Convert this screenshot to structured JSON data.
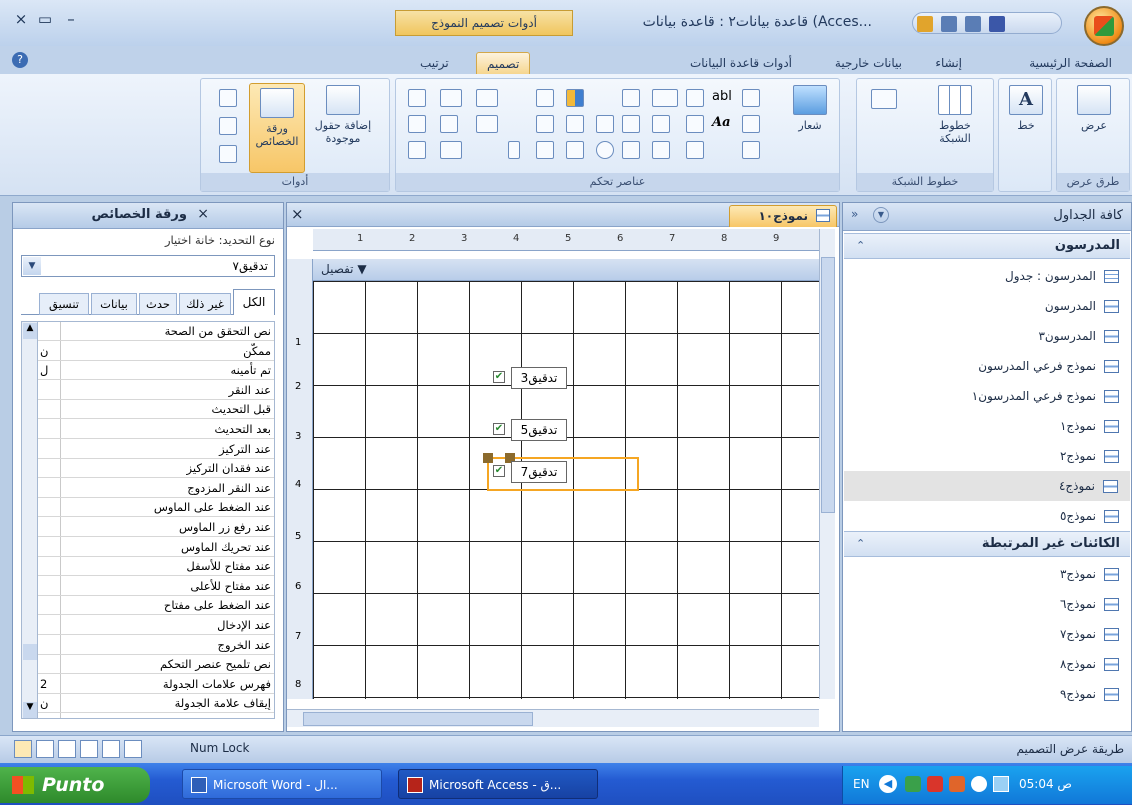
{
  "window": {
    "title": "قاعدة بيانات٢ : قاعدة بيانات (Acces...",
    "context_tab_group": "أدوات تصميم النموذج",
    "close_glyph": "×",
    "restore_glyph": "▭",
    "minimize_glyph": "–"
  },
  "tabs": [
    {
      "label": "الصفحة الرئيسية"
    },
    {
      "label": "إنشاء"
    },
    {
      "label": "بيانات خارجية"
    },
    {
      "label": "أدوات قاعدة البيانات"
    },
    {
      "label": "تصميم",
      "active": true
    },
    {
      "label": "ترتيب"
    }
  ],
  "ribbon": {
    "views_group": {
      "label": "طرق عرض",
      "button": "عرض"
    },
    "font_group": {
      "button_letter": "A",
      "button": "خط"
    },
    "gridlines_group": {
      "label": "خطوط الشبكة",
      "button": "خطوط الشبكة"
    },
    "controls_group": {
      "label": "عناصر تحكم",
      "logo_button": "شعار",
      "textbox_glyph": "abl",
      "label_glyph": "Aa"
    },
    "tools_group": {
      "label": "أدوات",
      "add_fields_button": "إضافة حقول موجودة",
      "property_sheet_button": "ورقة الخصائص"
    }
  },
  "properties": {
    "title": "ورقة الخصائص",
    "selection_type_label": "نوع التحديد:",
    "selection_type": "خانة اختيار",
    "selected_control": "تدقيق٧",
    "tabs": [
      "الكل",
      "غير ذلك",
      "حدث",
      "بيانات",
      "تنسيق"
    ],
    "rows": [
      {
        "name": "نص التحقق من الصحة",
        "value": ""
      },
      {
        "name": "ممكّن",
        "value": "ن"
      },
      {
        "name": "تم تأمينه",
        "value": "ل"
      },
      {
        "name": "عند النقر",
        "value": ""
      },
      {
        "name": "قبل التحديث",
        "value": ""
      },
      {
        "name": "بعد التحديث",
        "value": ""
      },
      {
        "name": "عند التركيز",
        "value": ""
      },
      {
        "name": "عند فقدان التركيز",
        "value": ""
      },
      {
        "name": "عند النقر المزدوج",
        "value": ""
      },
      {
        "name": "عند الضغط على الماوس",
        "value": ""
      },
      {
        "name": "عند رفع زر الماوس",
        "value": ""
      },
      {
        "name": "عند تحريك الماوس",
        "value": ""
      },
      {
        "name": "عند مفتاح للأسفل",
        "value": ""
      },
      {
        "name": "عند مفتاح للأعلى",
        "value": ""
      },
      {
        "name": "عند الضغط على مفتاح",
        "value": ""
      },
      {
        "name": "عند الإدخال",
        "value": ""
      },
      {
        "name": "عند الخروج",
        "value": ""
      },
      {
        "name": "نص تلميح عنصر التحكم",
        "value": ""
      },
      {
        "name": "فهرس علامات الجدولة",
        "value": "2"
      },
      {
        "name": "إيقاف علامة الجدولة",
        "value": "ن"
      }
    ]
  },
  "design": {
    "tab_label": "نموذج١٠",
    "section_label": "تفصيل",
    "ruler_numbers": [
      "1",
      "2",
      "3",
      "4",
      "5",
      "6",
      "7",
      "8",
      "9"
    ],
    "vruler_numbers": [
      "1",
      "2",
      "3",
      "4",
      "5",
      "6",
      "7",
      "8"
    ],
    "controls": [
      {
        "label": "تدقيق3"
      },
      {
        "label": "تدقيق5"
      },
      {
        "label": "تدقيق7",
        "selected": true
      }
    ]
  },
  "nav": {
    "title": "كافة الجداول",
    "groups": [
      {
        "name": "المدرسون",
        "items": [
          {
            "label": "المدرسون : جدول",
            "type": "table"
          },
          {
            "label": "المدرسون",
            "type": "form"
          },
          {
            "label": "المدرسون٣",
            "type": "form"
          },
          {
            "label": "نموذج فرعي المدرسون",
            "type": "form"
          },
          {
            "label": "نموذج فرعي المدرسون١",
            "type": "form"
          },
          {
            "label": "نموذج١",
            "type": "form"
          },
          {
            "label": "نموذج٢",
            "type": "form"
          },
          {
            "label": "نموذج٤",
            "type": "form",
            "selected": true
          },
          {
            "label": "نموذج٥",
            "type": "form"
          }
        ]
      },
      {
        "name": "الكائنات غير المرتبطة",
        "items": [
          {
            "label": "نموذج٣",
            "type": "form"
          },
          {
            "label": "نموذج٦",
            "type": "form"
          },
          {
            "label": "نموذج٧",
            "type": "form"
          },
          {
            "label": "نموذج٨",
            "type": "form"
          },
          {
            "label": "نموذج٩",
            "type": "form"
          }
        ]
      }
    ]
  },
  "status": {
    "left_text": "طريقة عرض التصميم",
    "num_lock": "Num Lock"
  },
  "taskbar": {
    "start": "Punto",
    "buttons": [
      {
        "label": "Microsoft Word - ال..."
      },
      {
        "label": "Microsoft Access - ق..."
      }
    ],
    "lang": "EN",
    "time": "05:04 ص"
  },
  "colors": {
    "accent": "#f0c55d",
    "selection_orange": "#f5a623",
    "checkbox_green": "#2a8a32"
  }
}
